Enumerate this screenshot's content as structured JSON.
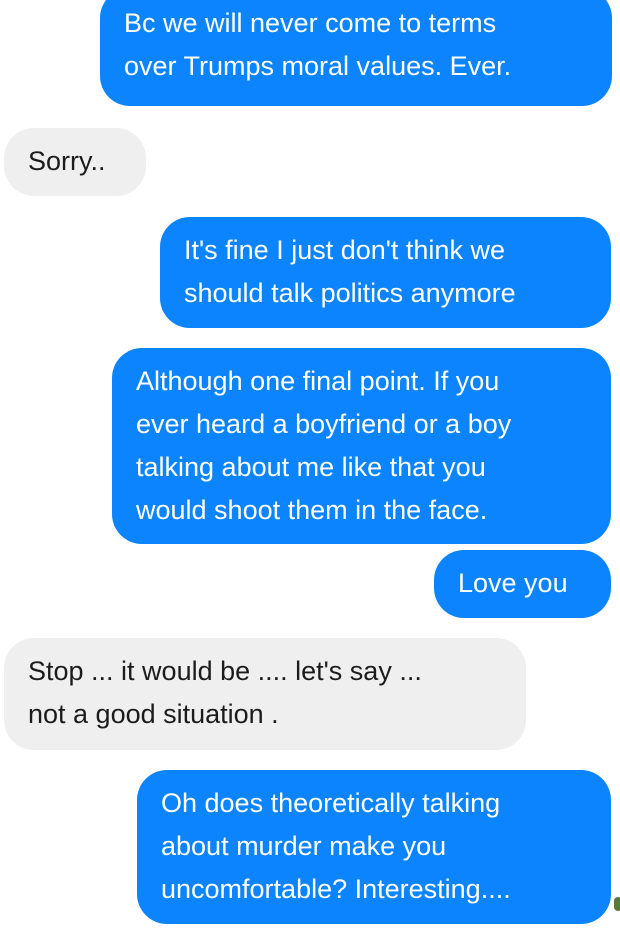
{
  "messages": [
    {
      "side": "sent",
      "lines": [
        "Bc we will never come to terms",
        "over Trumps moral values. Ever."
      ]
    },
    {
      "side": "received",
      "lines": [
        "Sorry.."
      ]
    },
    {
      "side": "sent",
      "lines": [
        "It's fine I just don't think we",
        "should talk politics anymore"
      ]
    },
    {
      "side": "sent",
      "lines": [
        "Although one final point. If you",
        "ever heard a boyfriend or a boy",
        "talking about me like that you",
        "would shoot them in the face."
      ]
    },
    {
      "side": "sent",
      "lines": [
        "Love you"
      ]
    },
    {
      "side": "received",
      "lines": [
        "Stop ... it would be .... let's say ...",
        "not a good situation ."
      ]
    },
    {
      "side": "sent",
      "lines": [
        "Oh does theoretically talking",
        "about murder make you",
        "uncomfortable? Interesting...."
      ]
    }
  ],
  "colors": {
    "sent_bubble": "#0b84fe",
    "received_bubble": "#efefef",
    "sent_text": "#ffffff",
    "received_text": "#1c1c1c"
  }
}
